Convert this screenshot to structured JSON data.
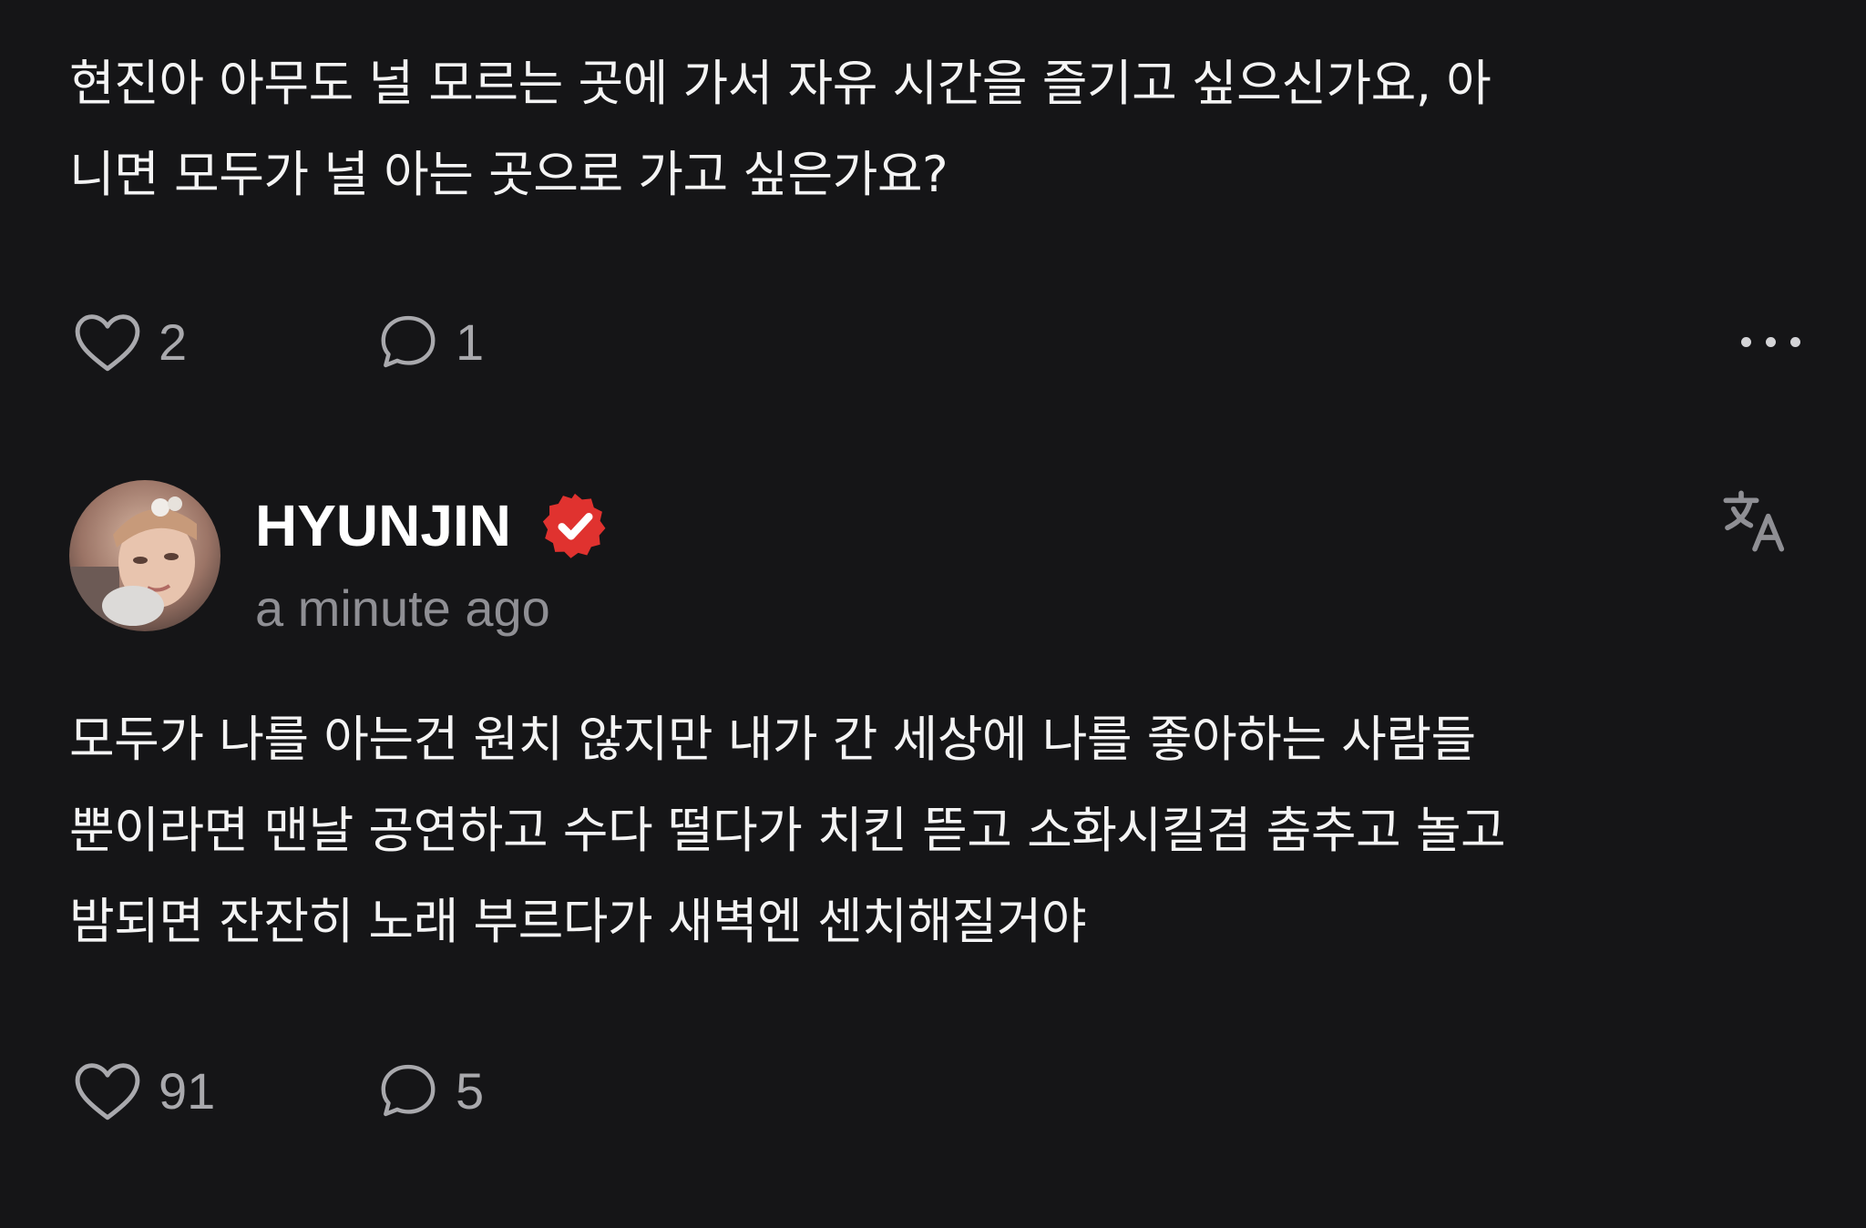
{
  "question": {
    "text_line1": "현진아 아무도 널 모르는 곳에 가서 자유 시간을 즐기고 싶으신가요, 아",
    "text_line2": "니면 모두가 널 아는 곳으로 가고 싶은가요?",
    "likes": "2",
    "comments": "1"
  },
  "reply": {
    "author": "HYUNJIN",
    "verified": true,
    "timestamp": "a minute ago",
    "text_line1": "모두가 나를 아는건 원치 않지만 내가 간 세상에 나를 좋아하는 사람들",
    "text_line2": "뿐이라면 맨날 공연하고 수다 떨다가 치킨 뜯고 소화시킬겸 춤추고 놀고",
    "text_line3": "밤되면 잔잔히 노래 부르다가 새벽엔 센치해질거야",
    "likes": "91",
    "comments": "5"
  },
  "icons": {
    "like": "heart-outline-icon",
    "comment": "speech-bubble-icon",
    "more": "more-dots-icon",
    "verified": "verified-badge-icon",
    "translate": "translate-icon"
  },
  "colors": {
    "background": "#151517",
    "text": "#f4f4f4",
    "secondary": "#8f8f94",
    "verified": "#e0322f"
  }
}
